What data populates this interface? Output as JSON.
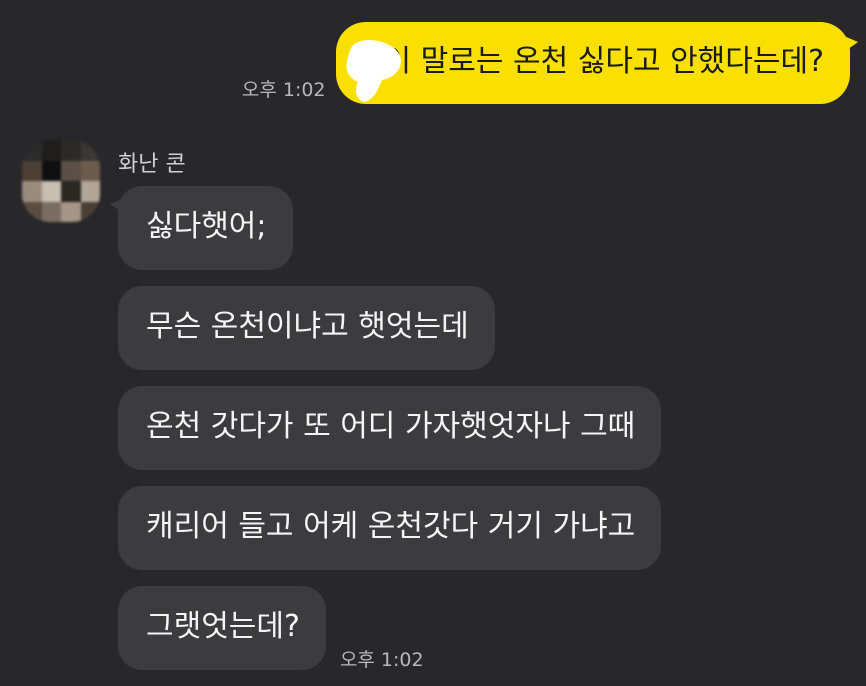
{
  "sent_message": {
    "text": "이 말로는 온천 싫다고 안했다는데?",
    "time": "오후 1:02"
  },
  "received": {
    "sender_name": "화난 콘",
    "messages": [
      {
        "text": "싫다햇어;"
      },
      {
        "text": "무슨 온천이냐고 햇엇는데"
      },
      {
        "text": "온천 갓다가 또 어디 가자햇엇자나 그때"
      },
      {
        "text": "캐리어 들고 어케 온천갓다 거기 가냐고"
      },
      {
        "text": "그랫엇는데?"
      }
    ],
    "last_time": "오후 1:02"
  },
  "colors": {
    "background": "#28282a",
    "sent_bubble": "#fae000",
    "received_bubble": "#3c3c3f"
  },
  "icons": {
    "avatar": "pixelated-profile-avatar",
    "censor": "white-censor-blob"
  }
}
